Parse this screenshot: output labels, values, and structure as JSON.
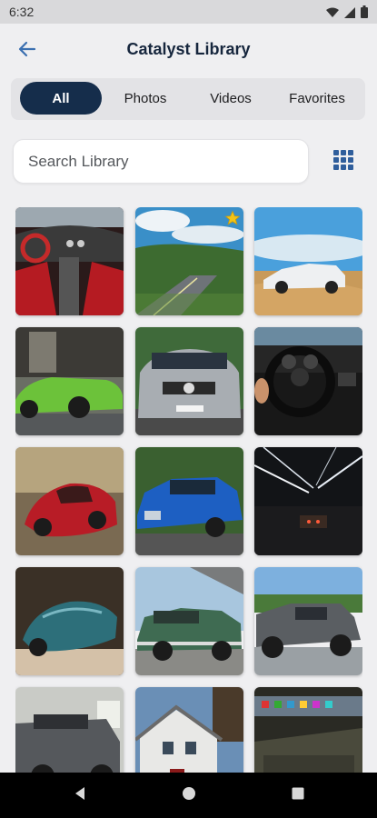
{
  "status_bar": {
    "time": "6:32"
  },
  "header": {
    "title": "Catalyst Library"
  },
  "tabs": [
    {
      "label": "All",
      "active": true
    },
    {
      "label": "Photos",
      "active": false
    },
    {
      "label": "Videos",
      "active": false
    },
    {
      "label": "Favorites",
      "active": false
    }
  ],
  "search": {
    "placeholder": "Search Library"
  },
  "icons": {
    "back": "arrow-left-icon",
    "view_toggle": "grid-icon",
    "favorite": "star-icon",
    "wifi": "wifi-icon",
    "signal": "signal-icon",
    "battery": "battery-icon"
  },
  "colors": {
    "accent": "#152d4b",
    "favorite_star": "#f2c316",
    "background": "#efeff1"
  },
  "gallery": {
    "items": [
      {
        "subject": "red car interior",
        "favorite": false
      },
      {
        "subject": "mountain road",
        "favorite": true
      },
      {
        "subject": "white sedan on dirt track",
        "favorite": false
      },
      {
        "subject": "green sports car",
        "favorite": false
      },
      {
        "subject": "silver car front",
        "favorite": false
      },
      {
        "subject": "steering wheel dashboard",
        "favorite": false
      },
      {
        "subject": "red sports coupe",
        "favorite": false
      },
      {
        "subject": "blue sedan",
        "favorite": false
      },
      {
        "subject": "night road light trails",
        "favorite": false
      },
      {
        "subject": "teal concept car",
        "favorite": false
      },
      {
        "subject": "green vintage car",
        "favorite": false
      },
      {
        "subject": "gray pickup truck",
        "favorite": false
      },
      {
        "subject": "gray jeep in garage",
        "favorite": false
      },
      {
        "subject": "white house",
        "favorite": false
      },
      {
        "subject": "dashboard screen",
        "favorite": false
      }
    ]
  }
}
